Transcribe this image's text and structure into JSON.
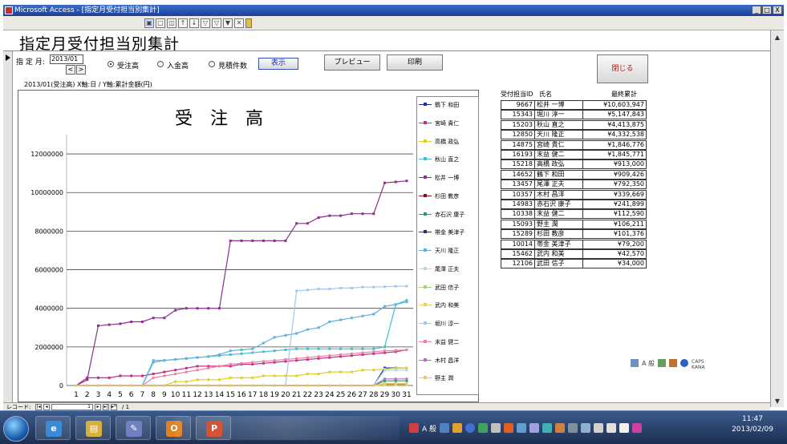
{
  "window": {
    "title": "Microsoft Access - [指定月受付担当別集計]",
    "min_label": "_",
    "max_label": "□",
    "close_label": "X"
  },
  "form": {
    "title": "指定月受付担当別集計",
    "month_label": "指 定 月:",
    "month_value": "2013/01",
    "prev_label": "<",
    "next_label": ">",
    "radio_options": [
      {
        "label": "受注高",
        "selected": true
      },
      {
        "label": "入金高",
        "selected": false
      },
      {
        "label": "見積件数",
        "selected": false
      }
    ],
    "show_button": "表示",
    "preview_button": "プレビュー",
    "print_button": "印刷",
    "close_button": "閉じる",
    "caption": "2013/01(受注高)  X軸:日 / Y軸:累計金額(円)"
  },
  "chart_data": {
    "type": "line",
    "title": "受　注　高",
    "xlabel": "",
    "ylabel": "",
    "x": [
      1,
      2,
      3,
      4,
      5,
      6,
      7,
      8,
      9,
      10,
      11,
      12,
      13,
      14,
      15,
      16,
      17,
      18,
      19,
      20,
      21,
      22,
      23,
      24,
      25,
      26,
      27,
      28,
      29,
      30,
      31
    ],
    "ylim": [
      0,
      13000000
    ],
    "yticks": [
      0,
      2000000,
      4000000,
      6000000,
      8000000,
      10000000,
      12000000
    ],
    "ytick_labels": [
      "0",
      "2000000",
      "4000000",
      "6000000",
      "8000000",
      "10000000",
      "12000000"
    ],
    "grid": true,
    "legend_position": "right",
    "series": [
      {
        "name": "鶴下 和田",
        "color": "#1a2f9a",
        "values": [
          0,
          0,
          0,
          0,
          0,
          0,
          0,
          0,
          0,
          0,
          0,
          0,
          0,
          0,
          0,
          0,
          0,
          0,
          0,
          0,
          0,
          0,
          0,
          0,
          0,
          0,
          0,
          0,
          909426,
          909426,
          909426
        ]
      },
      {
        "name": "宮崎 貴仁",
        "color": "#c0308a",
        "values": [
          0,
          400000,
          400000,
          400000,
          500000,
          500000,
          500000,
          600000,
          700000,
          800000,
          900000,
          1000000,
          1000000,
          1000000,
          1000000,
          1100000,
          1100000,
          1150000,
          1200000,
          1250000,
          1300000,
          1350000,
          1400000,
          1450000,
          1500000,
          1550000,
          1600000,
          1650000,
          1700000,
          1750000,
          1846776
        ]
      },
      {
        "name": "高橋 政弘",
        "color": "#e0d020",
        "values": [
          0,
          0,
          0,
          0,
          0,
          0,
          0,
          0,
          0,
          200000,
          200000,
          300000,
          300000,
          300000,
          400000,
          400000,
          400000,
          500000,
          500000,
          500000,
          500000,
          600000,
          600000,
          700000,
          700000,
          700000,
          800000,
          800000,
          850000,
          900000,
          913000
        ]
      },
      {
        "name": "秋山 直之",
        "color": "#40c0d0",
        "values": [
          0,
          0,
          0,
          0,
          0,
          0,
          0,
          1200000,
          1300000,
          1350000,
          1400000,
          1450000,
          1500000,
          1550000,
          1600000,
          1650000,
          1700000,
          1750000,
          1800000,
          1850000,
          1900000,
          1900000,
          1900000,
          1900000,
          1900000,
          1900000,
          1900000,
          1900000,
          2000000,
          4200000,
          4413875
        ]
      },
      {
        "name": "松井 一博",
        "color": "#8a3090",
        "values": [
          0,
          300000,
          3100000,
          3150000,
          3200000,
          3300000,
          3300000,
          3500000,
          3500000,
          3900000,
          4000000,
          4000000,
          4000000,
          4000000,
          7500000,
          7500000,
          7500000,
          7500000,
          7500000,
          7500000,
          8400000,
          8400000,
          8700000,
          8800000,
          8800000,
          8900000,
          8900000,
          8900000,
          10500000,
          10550000,
          10603947
        ]
      },
      {
        "name": "杉田 教彦",
        "color": "#801020",
        "values": [
          0,
          0,
          0,
          0,
          0,
          0,
          0,
          0,
          0,
          0,
          0,
          0,
          0,
          0,
          0,
          0,
          0,
          0,
          0,
          0,
          0,
          0,
          0,
          0,
          0,
          0,
          0,
          0,
          101376,
          101376,
          101376
        ]
      },
      {
        "name": "赤石沢 康子",
        "color": "#20a060",
        "values": [
          0,
          0,
          0,
          0,
          0,
          0,
          0,
          0,
          0,
          0,
          0,
          0,
          0,
          0,
          0,
          0,
          0,
          0,
          0,
          0,
          0,
          0,
          0,
          0,
          0,
          0,
          0,
          0,
          241899,
          241899,
          241899
        ]
      },
      {
        "name": "帯金 美津子",
        "color": "#203070",
        "values": [
          0,
          0,
          0,
          0,
          0,
          0,
          0,
          0,
          0,
          0,
          0,
          0,
          0,
          0,
          0,
          0,
          0,
          0,
          0,
          0,
          0,
          0,
          0,
          0,
          0,
          0,
          0,
          0,
          79200,
          79200,
          79200
        ]
      },
      {
        "name": "天川 隆正",
        "color": "#60b0e0",
        "values": [
          0,
          0,
          0,
          0,
          0,
          0,
          0,
          1300000,
          1300000,
          1350000,
          1400000,
          1450000,
          1500000,
          1600000,
          1800000,
          1850000,
          1900000,
          2200000,
          2500000,
          2600000,
          2700000,
          2900000,
          3000000,
          3300000,
          3400000,
          3500000,
          3600000,
          3700000,
          4100000,
          4200000,
          4332538
        ]
      },
      {
        "name": "尾澤 正夫",
        "color": "#b0d8f0",
        "values": [
          0,
          0,
          0,
          0,
          0,
          0,
          0,
          0,
          0,
          0,
          0,
          0,
          0,
          0,
          0,
          0,
          0,
          0,
          0,
          0,
          0,
          0,
          0,
          0,
          0,
          0,
          0,
          0,
          792350,
          792350,
          792350
        ]
      },
      {
        "name": "武田 信子",
        "color": "#a8d080",
        "values": [
          0,
          0,
          0,
          0,
          0,
          0,
          0,
          0,
          0,
          0,
          0,
          0,
          0,
          0,
          0,
          0,
          0,
          0,
          0,
          0,
          0,
          0,
          0,
          0,
          0,
          0,
          0,
          0,
          34000,
          34000,
          34000
        ]
      },
      {
        "name": "武内 和美",
        "color": "#f0d060",
        "values": [
          0,
          0,
          0,
          0,
          0,
          0,
          0,
          0,
          0,
          0,
          0,
          0,
          0,
          0,
          0,
          0,
          0,
          0,
          0,
          0,
          0,
          0,
          0,
          0,
          0,
          0,
          0,
          0,
          42570,
          42570,
          42570
        ]
      },
      {
        "name": "堀川 淳一",
        "color": "#a0c8f0",
        "values": [
          0,
          0,
          0,
          0,
          0,
          0,
          0,
          0,
          0,
          0,
          0,
          0,
          0,
          0,
          0,
          0,
          0,
          0,
          0,
          0,
          4900000,
          4950000,
          5000000,
          5000000,
          5050000,
          5050000,
          5100000,
          5100000,
          5120000,
          5140000,
          5147843
        ]
      },
      {
        "name": "末益 健二",
        "color": "#f080a0",
        "values": [
          0,
          0,
          0,
          0,
          0,
          0,
          0,
          400000,
          500000,
          600000,
          700000,
          800000,
          900000,
          1000000,
          1100000,
          1150000,
          1200000,
          1250000,
          1300000,
          1350000,
          1400000,
          1450000,
          1500000,
          1550000,
          1600000,
          1650000,
          1700000,
          1750000,
          1800000,
          1820000,
          1845771
        ]
      },
      {
        "name": "木村 昌洋",
        "color": "#b070c0",
        "values": [
          0,
          0,
          0,
          0,
          0,
          0,
          0,
          0,
          0,
          0,
          0,
          0,
          0,
          0,
          0,
          0,
          0,
          0,
          0,
          0,
          0,
          0,
          0,
          0,
          0,
          0,
          0,
          0,
          339669,
          339669,
          339669
        ]
      },
      {
        "name": "野主 潤",
        "color": "#e8c870",
        "values": [
          0,
          0,
          0,
          0,
          0,
          0,
          0,
          0,
          0,
          0,
          0,
          0,
          0,
          0,
          0,
          0,
          0,
          0,
          0,
          0,
          0,
          0,
          0,
          0,
          0,
          0,
          0,
          0,
          106211,
          106211,
          106211
        ]
      }
    ]
  },
  "table": {
    "headers": [
      "受付担当ID",
      "氏名",
      "最終累計"
    ],
    "rows": [
      {
        "id": "9667",
        "name": "松井 一博",
        "total": "¥10,603,947"
      },
      {
        "id": "15343",
        "name": "堀川 淳一",
        "total": "¥5,147,843"
      },
      {
        "id": "15203",
        "name": "秋山 直之",
        "total": "¥4,413,875"
      },
      {
        "id": "12850",
        "name": "天川 隆正",
        "total": "¥4,332,538"
      },
      {
        "id": "14875",
        "name": "宮崎 貴仁",
        "total": "¥1,846,776"
      },
      {
        "id": "16193",
        "name": "末益 健二",
        "total": "¥1,845,771"
      },
      {
        "id": "15218",
        "name": "高橋 政弘",
        "total": "¥913,000"
      },
      {
        "id": "14652",
        "name": "鶴下 和田",
        "total": "¥909,426"
      },
      {
        "id": "13457",
        "name": "尾澤 正夫",
        "total": "¥792,350"
      },
      {
        "id": "10357",
        "name": "木村 昌洋",
        "total": "¥339,669"
      },
      {
        "id": "14983",
        "name": "赤石沢 康子",
        "total": "¥241,899"
      },
      {
        "id": "10338",
        "name": "末益 健二",
        "total": "¥112,590"
      },
      {
        "id": "15093",
        "name": "野主 潤",
        "total": "¥106,211"
      },
      {
        "id": "15289",
        "name": "杉田 教彦",
        "total": "¥101,376"
      },
      {
        "id": "10014",
        "name": "帯金 美津子",
        "total": "¥79,200"
      },
      {
        "id": "15462",
        "name": "武内 和美",
        "total": "¥42,570"
      },
      {
        "id": "12106",
        "name": "武田 信子",
        "total": "¥34,000"
      }
    ]
  },
  "ime_bar": {
    "mode_label": "A 般",
    "caps_label": "CAPS KANA"
  },
  "nav": {
    "record_label": "レコード:",
    "record_value": "1",
    "of_label": "/ 1"
  },
  "taskbar": {
    "time": "11:47",
    "date": "2013/02/09",
    "tray_mode": "A 般",
    "apps": [
      {
        "name": "ie",
        "glyph": "e",
        "color": "#3a8ad8"
      },
      {
        "name": "explorer",
        "glyph": "▤",
        "color": "#d8b040"
      },
      {
        "name": "paint",
        "glyph": "✎",
        "color": "#7080c0"
      },
      {
        "name": "outlook",
        "glyph": "O",
        "color": "#e08020"
      },
      {
        "name": "powerpoint",
        "glyph": "P",
        "color": "#d04020"
      }
    ]
  }
}
